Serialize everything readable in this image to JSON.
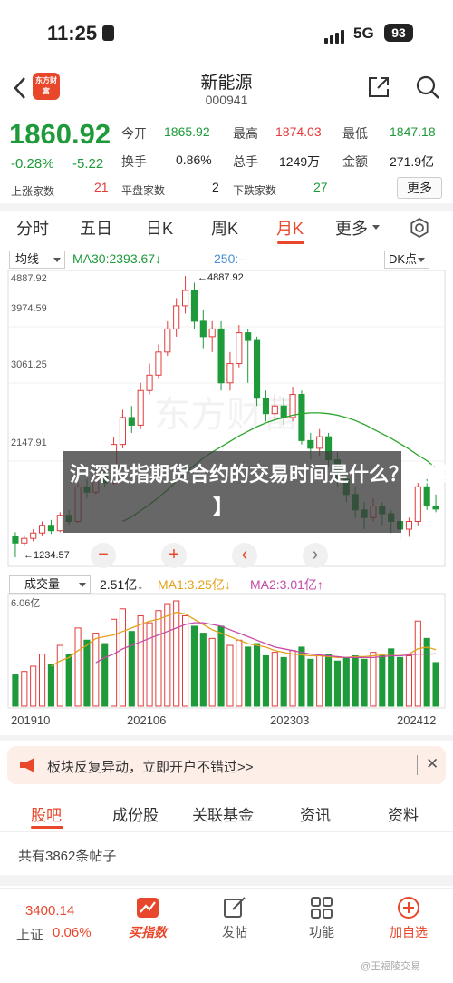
{
  "status_bar": {
    "time": "11:25",
    "network": "5G",
    "battery": "93"
  },
  "header": {
    "app_logo_text": "东方财富",
    "title": "新能源",
    "code": "000941"
  },
  "quote": {
    "price": "1860.92",
    "change_pct": "-0.28%",
    "change": "-5.22",
    "open_label": "今开",
    "open": "1865.92",
    "high_label": "最高",
    "high": "1874.03",
    "low_label": "最低",
    "low": "1847.18",
    "turnover_label": "换手",
    "turnover": "0.86%",
    "volume_label": "总手",
    "volume": "1249万",
    "amount_label": "金额",
    "amount": "271.9亿",
    "up_label": "上涨家数",
    "up_count": "21",
    "flat_label": "平盘家数",
    "flat_count": "2",
    "down_label": "下跌家数",
    "down_count": "27",
    "more_label": "更多"
  },
  "period_tabs": [
    "分时",
    "五日",
    "日K",
    "周K",
    "月K",
    "更多"
  ],
  "active_period": "月K",
  "chart": {
    "indicator_select": "均线",
    "ma30_label": "MA30:2393.67↓",
    "ma250_label": "250:--",
    "dk_label": "DK点",
    "y_ticks": [
      "4887.92",
      "3974.59",
      "3061.25",
      "2147.91"
    ],
    "high_marker": "4887.92",
    "low_marker": "1234.57",
    "overlay_line1": "沪深股指期货合约的交易时间是什么？【最新",
    "overlay_line2": "】",
    "zoom_out": "−",
    "zoom_in": "+",
    "prev": "‹",
    "next": "›",
    "volume_select": "成交量",
    "volume_value": "2.51亿↓",
    "ma1_label": "MA1:3.25亿↓",
    "ma2_label": "MA2:3.01亿↑",
    "volume_max": "6.06亿",
    "dates": [
      "201910",
      "202106",
      "202303",
      "202412"
    ],
    "colors": {
      "up": "#e23b3b",
      "down": "#1e9a3a",
      "ma30": "#2aa52a",
      "ma1": "#e3a21a",
      "ma2": "#c54aa8"
    }
  },
  "chart_data": {
    "type": "candlestick",
    "candles": [
      {
        "o": 1500,
        "c": 1420,
        "h": 1560,
        "l": 1234.57
      },
      {
        "o": 1420,
        "c": 1480,
        "h": 1520,
        "l": 1380
      },
      {
        "o": 1480,
        "c": 1550,
        "h": 1600,
        "l": 1440
      },
      {
        "o": 1550,
        "c": 1650,
        "h": 1700,
        "l": 1520
      },
      {
        "o": 1650,
        "c": 1580,
        "h": 1720,
        "l": 1540
      },
      {
        "o": 1580,
        "c": 1780,
        "h": 1820,
        "l": 1560
      },
      {
        "o": 1780,
        "c": 1700,
        "h": 1850,
        "l": 1660
      },
      {
        "o": 1700,
        "c": 2150,
        "h": 2200,
        "l": 1680
      },
      {
        "o": 2150,
        "c": 2080,
        "h": 2250,
        "l": 2000
      },
      {
        "o": 2080,
        "c": 2300,
        "h": 2400,
        "l": 2050
      },
      {
        "o": 2300,
        "c": 2200,
        "h": 2380,
        "l": 2150
      },
      {
        "o": 2200,
        "c": 2700,
        "h": 2800,
        "l": 2180
      },
      {
        "o": 2700,
        "c": 3050,
        "h": 3150,
        "l": 2650
      },
      {
        "o": 3050,
        "c": 2950,
        "h": 3200,
        "l": 2850
      },
      {
        "o": 2950,
        "c": 3400,
        "h": 3500,
        "l": 2900
      },
      {
        "o": 3400,
        "c": 3600,
        "h": 3750,
        "l": 3350
      },
      {
        "o": 3600,
        "c": 3900,
        "h": 4000,
        "l": 3550
      },
      {
        "o": 3900,
        "c": 4200,
        "h": 4300,
        "l": 3850
      },
      {
        "o": 4200,
        "c": 4500,
        "h": 4600,
        "l": 4100
      },
      {
        "o": 4500,
        "c": 4700,
        "h": 4887.92,
        "l": 4400
      },
      {
        "o": 4700,
        "c": 4300,
        "h": 4800,
        "l": 4200
      },
      {
        "o": 4300,
        "c": 4100,
        "h": 4450,
        "l": 3950
      },
      {
        "o": 4100,
        "c": 4200,
        "h": 4300,
        "l": 3900
      },
      {
        "o": 4200,
        "c": 3500,
        "h": 4300,
        "l": 3400
      },
      {
        "o": 3500,
        "c": 3750,
        "h": 3900,
        "l": 3400
      },
      {
        "o": 3750,
        "c": 4150,
        "h": 4250,
        "l": 3700
      },
      {
        "o": 4150,
        "c": 4050,
        "h": 4200,
        "l": 3500
      },
      {
        "o": 4050,
        "c": 3300,
        "h": 4100,
        "l": 3200
      },
      {
        "o": 3300,
        "c": 3100,
        "h": 3400,
        "l": 3000
      },
      {
        "o": 3100,
        "c": 3200,
        "h": 3350,
        "l": 3000
      },
      {
        "o": 3200,
        "c": 3050,
        "h": 3300,
        "l": 2950
      },
      {
        "o": 3050,
        "c": 3350,
        "h": 3450,
        "l": 3000
      },
      {
        "o": 3350,
        "c": 2750,
        "h": 3400,
        "l": 2700
      },
      {
        "o": 2750,
        "c": 2650,
        "h": 2850,
        "l": 2500
      },
      {
        "o": 2650,
        "c": 2800,
        "h": 2900,
        "l": 2550
      },
      {
        "o": 2800,
        "c": 2500,
        "h": 2850,
        "l": 2400
      },
      {
        "o": 2500,
        "c": 2250,
        "h": 2600,
        "l": 2150
      },
      {
        "o": 2250,
        "c": 2050,
        "h": 2300,
        "l": 1950
      },
      {
        "o": 2050,
        "c": 1850,
        "h": 2150,
        "l": 1750
      },
      {
        "o": 1850,
        "c": 1750,
        "h": 1950,
        "l": 1600
      },
      {
        "o": 1750,
        "c": 1900,
        "h": 2000,
        "l": 1700
      },
      {
        "o": 1900,
        "c": 1800,
        "h": 1950,
        "l": 1650
      },
      {
        "o": 1800,
        "c": 1700,
        "h": 1850,
        "l": 1550
      },
      {
        "o": 1700,
        "c": 1600,
        "h": 1800,
        "l": 1450
      },
      {
        "o": 1600,
        "c": 1700,
        "h": 1750,
        "l": 1500
      },
      {
        "o": 1700,
        "c": 2150,
        "h": 2200,
        "l": 1650
      },
      {
        "o": 2150,
        "c": 1900,
        "h": 2250,
        "l": 1850
      },
      {
        "o": 1900,
        "c": 1860.92,
        "h": 2050,
        "l": 1820
      }
    ],
    "ma30": [
      null,
      null,
      null,
      null,
      null,
      null,
      null,
      null,
      null,
      null,
      null,
      null,
      1700,
      1760,
      1840,
      1920,
      2010,
      2110,
      2220,
      2330,
      2430,
      2520,
      2600,
      2670,
      2740,
      2810,
      2870,
      2930,
      2980,
      3020,
      3050,
      3080,
      3100,
      3110,
      3110,
      3100,
      3080,
      3050,
      3010,
      2960,
      2900,
      2840,
      2780,
      2710,
      2640,
      2560,
      2490,
      2393.67
    ],
    "volume": [
      1.8,
      2.0,
      2.3,
      3.0,
      2.4,
      3.5,
      3.0,
      4.5,
      3.8,
      4.2,
      3.6,
      5.0,
      5.6,
      4.3,
      5.2,
      4.8,
      5.5,
      5.9,
      6.06,
      5.2,
      4.6,
      4.2,
      3.9,
      4.6,
      3.5,
      3.8,
      3.4,
      3.6,
      2.9,
      3.1,
      2.8,
      3.2,
      3.4,
      2.7,
      2.9,
      3.0,
      2.6,
      2.8,
      2.9,
      2.7,
      3.1,
      2.9,
      3.3,
      2.8,
      2.9,
      4.9,
      3.9,
      2.51
    ],
    "ma1": [
      null,
      null,
      null,
      null,
      2.3,
      2.6,
      2.8,
      3.2,
      3.5,
      3.9,
      4.0,
      4.1,
      4.3,
      4.5,
      4.7,
      4.9,
      5.0,
      5.2,
      5.4,
      5.3,
      5.0,
      4.7,
      4.4,
      4.2,
      4.0,
      3.8,
      3.6,
      3.5,
      3.4,
      3.2,
      3.1,
      3.0,
      2.95,
      2.9,
      2.9,
      2.85,
      2.8,
      2.8,
      2.85,
      2.85,
      2.9,
      2.95,
      3.0,
      3.0,
      3.0,
      3.3,
      3.4,
      3.25
    ],
    "ma2": [
      null,
      null,
      null,
      null,
      null,
      null,
      null,
      null,
      null,
      2.5,
      2.8,
      3.0,
      3.3,
      3.5,
      3.7,
      3.9,
      4.1,
      4.3,
      4.5,
      4.7,
      4.8,
      4.8,
      4.7,
      4.6,
      4.4,
      4.2,
      4.0,
      3.8,
      3.6,
      3.4,
      3.3,
      3.2,
      3.1,
      3.0,
      2.95,
      2.9,
      2.85,
      2.8,
      2.8,
      2.8,
      2.8,
      2.85,
      2.9,
      2.9,
      2.95,
      3.0,
      3.0,
      3.01
    ],
    "ylim": [
      1234.57,
      4887.92
    ],
    "volume_max": 6.06
  },
  "banner": {
    "text": "板块反复异动，立即开户不错过>>",
    "close": "✕"
  },
  "content_tabs": [
    "股吧",
    "成份股",
    "关联基金",
    "资讯",
    "资料"
  ],
  "active_content_tab": "股吧",
  "posts_count": "共有3862条帖子",
  "bottom_nav": {
    "index_value": "3400.14",
    "index_name": "上证",
    "index_pct": "0.06%",
    "items": [
      "买指数",
      "发帖",
      "功能",
      "加自选"
    ]
  },
  "watermark": "@王福陵交易"
}
